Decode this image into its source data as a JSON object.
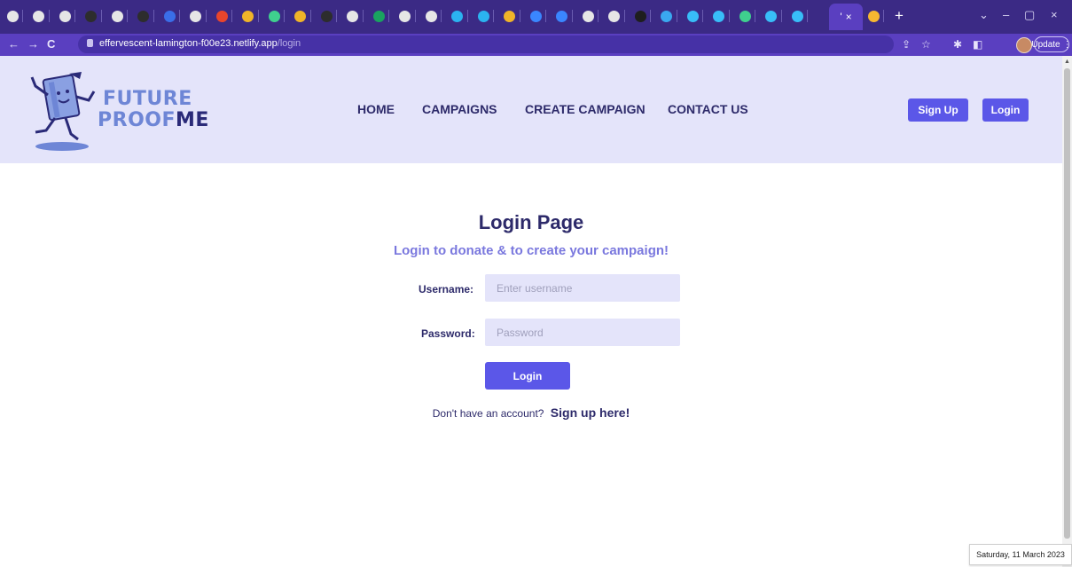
{
  "browser": {
    "tab_favicons": [
      "#e6e6e6",
      "#e6e6e6",
      "#e6e6e6",
      "#2d2d2d",
      "#e6e6e6",
      "#2d2d2d",
      "#3a6ee8",
      "#e6e6e6",
      "#e8452c",
      "#f0b429",
      "#3fcf8e",
      "#f0b429",
      "#2d2d2d",
      "#e6e6e6",
      "#1aa260",
      "#e6e6e6",
      "#e6e6e6",
      "#2bb3f0",
      "#2bb3f0",
      "#f0b429",
      "#3a86ff",
      "#3a86ff",
      "#e6e6e6",
      "#e6e6e6",
      "#1e1e1e",
      "#3aa8f0",
      "#38bdf8",
      "#38bdf8",
      "#3fcf8e",
      "#38bdf8",
      "#38bdf8",
      "#f7b731"
    ],
    "active_tab_title": "'",
    "active_tab_close": "×",
    "new_tab": "+",
    "window_controls": {
      "tab_search": "⌄",
      "minimize": "–",
      "restore": "▢",
      "close": "×"
    },
    "nav": {
      "back": "←",
      "forward": "→",
      "reload": "C"
    },
    "url_host": "effervescent-lamington-f00e23.netlify.app",
    "url_path": "/login",
    "update_label": "Update"
  },
  "site": {
    "brand_line1": "FUTURE",
    "brand_line2_a": "PROOF",
    "brand_line2_b": "ME",
    "nav": {
      "home": "HOME",
      "campaigns": "CAMPAIGNS",
      "create_campaign": "CREATE CAMPAIGN",
      "contact": "CONTACT US"
    },
    "signup_button": "Sign Up",
    "login_button": "Login"
  },
  "login": {
    "title": "Login Page",
    "subtitle": "Login to donate & to create your campaign!",
    "username_label": "Username:",
    "username_placeholder": "Enter username",
    "password_label": "Password:",
    "password_placeholder": "Password",
    "submit": "Login",
    "no_account": "Don't have an account?",
    "signup_link": "Sign up here!"
  },
  "taskbar": {
    "date": "Saturday, 11 March 2023"
  },
  "colors": {
    "accent": "#5b57e8",
    "header_bg": "#e4e4fa",
    "navy": "#2d2a6a",
    "brand_blue": "#6e86d6",
    "browser_frame": "#3b2a85"
  }
}
